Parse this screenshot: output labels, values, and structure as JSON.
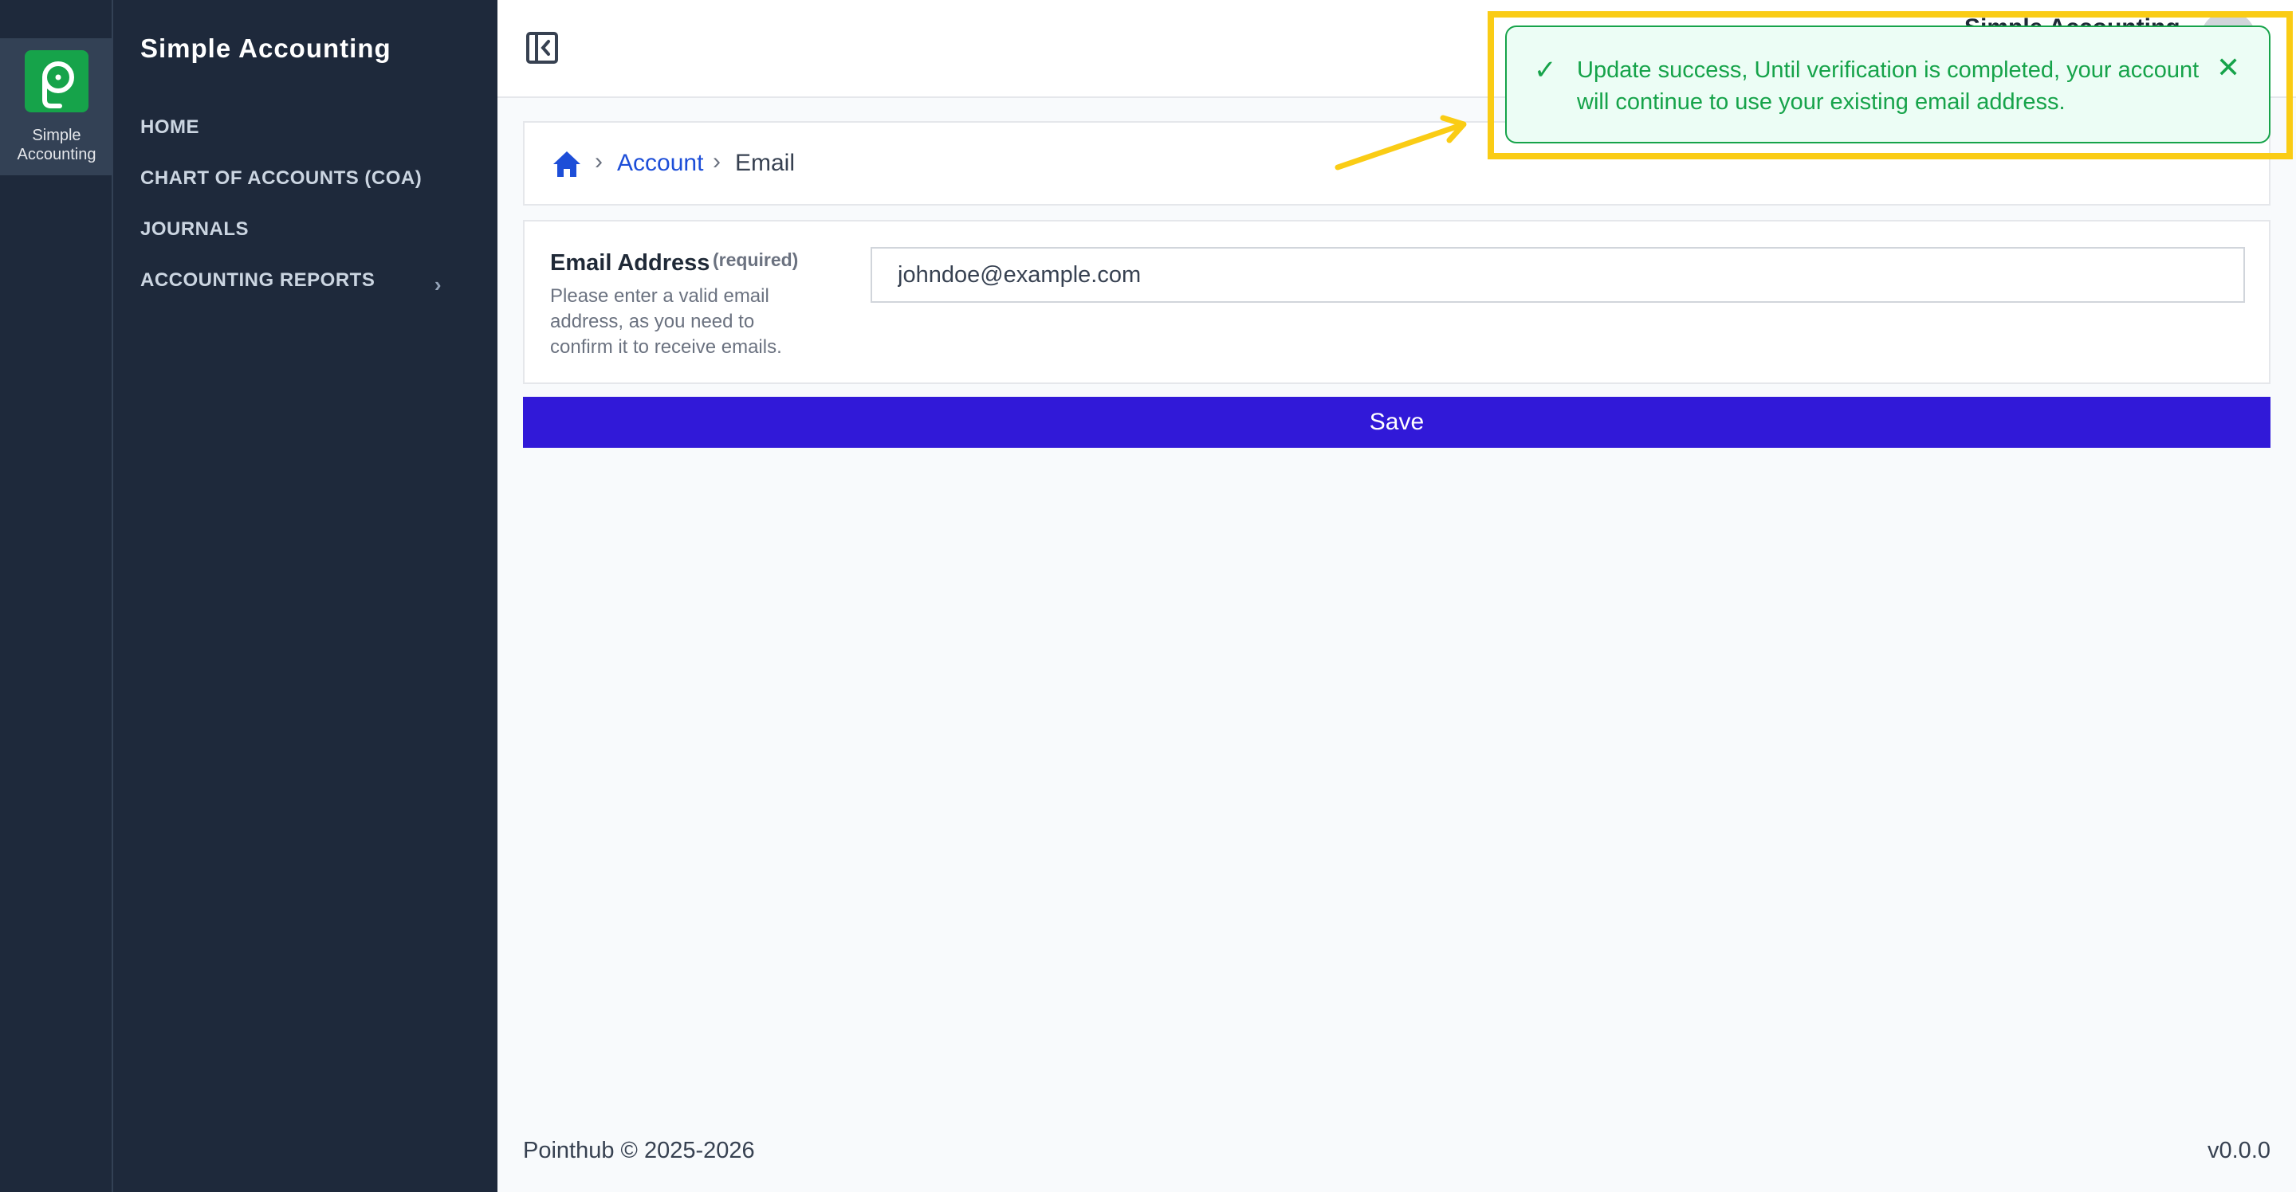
{
  "app": {
    "rail_label": "Simple Accounting",
    "brand": "Simple Accounting",
    "logo_color": "#16a34a",
    "logo_icon": "pointhub-p-logo"
  },
  "sidebar": {
    "items": [
      {
        "label": "HOME"
      },
      {
        "label": "CHART OF ACCOUNTS (COA)"
      },
      {
        "label": "JOURNALS"
      },
      {
        "label": "ACCOUNTING REPORTS",
        "has_submenu": true
      }
    ]
  },
  "topbar": {
    "collapse_icon": "sidebar-collapse-icon",
    "profile_name": "Simple Accounting"
  },
  "breadcrumb": {
    "home_icon": "home-icon",
    "items": [
      "Account",
      "Email"
    ]
  },
  "form": {
    "label": "Email Address",
    "required_tag": "(required)",
    "help": "Please enter a valid email address, as you need to confirm it to receive emails.",
    "value": "johndoe@example.com",
    "save_label": "Save",
    "accent": "#3119d8"
  },
  "toast": {
    "message": "Update success, Until verification is completed, your account will continue to use your existing email address.",
    "check_icon": "check-icon",
    "close_icon": "close-icon",
    "status_color": "#16a34a"
  },
  "annotation": {
    "highlight_color": "#facc15"
  },
  "footer": {
    "copyright": "Pointhub © 2025-2026",
    "version": "v0.0.0"
  }
}
